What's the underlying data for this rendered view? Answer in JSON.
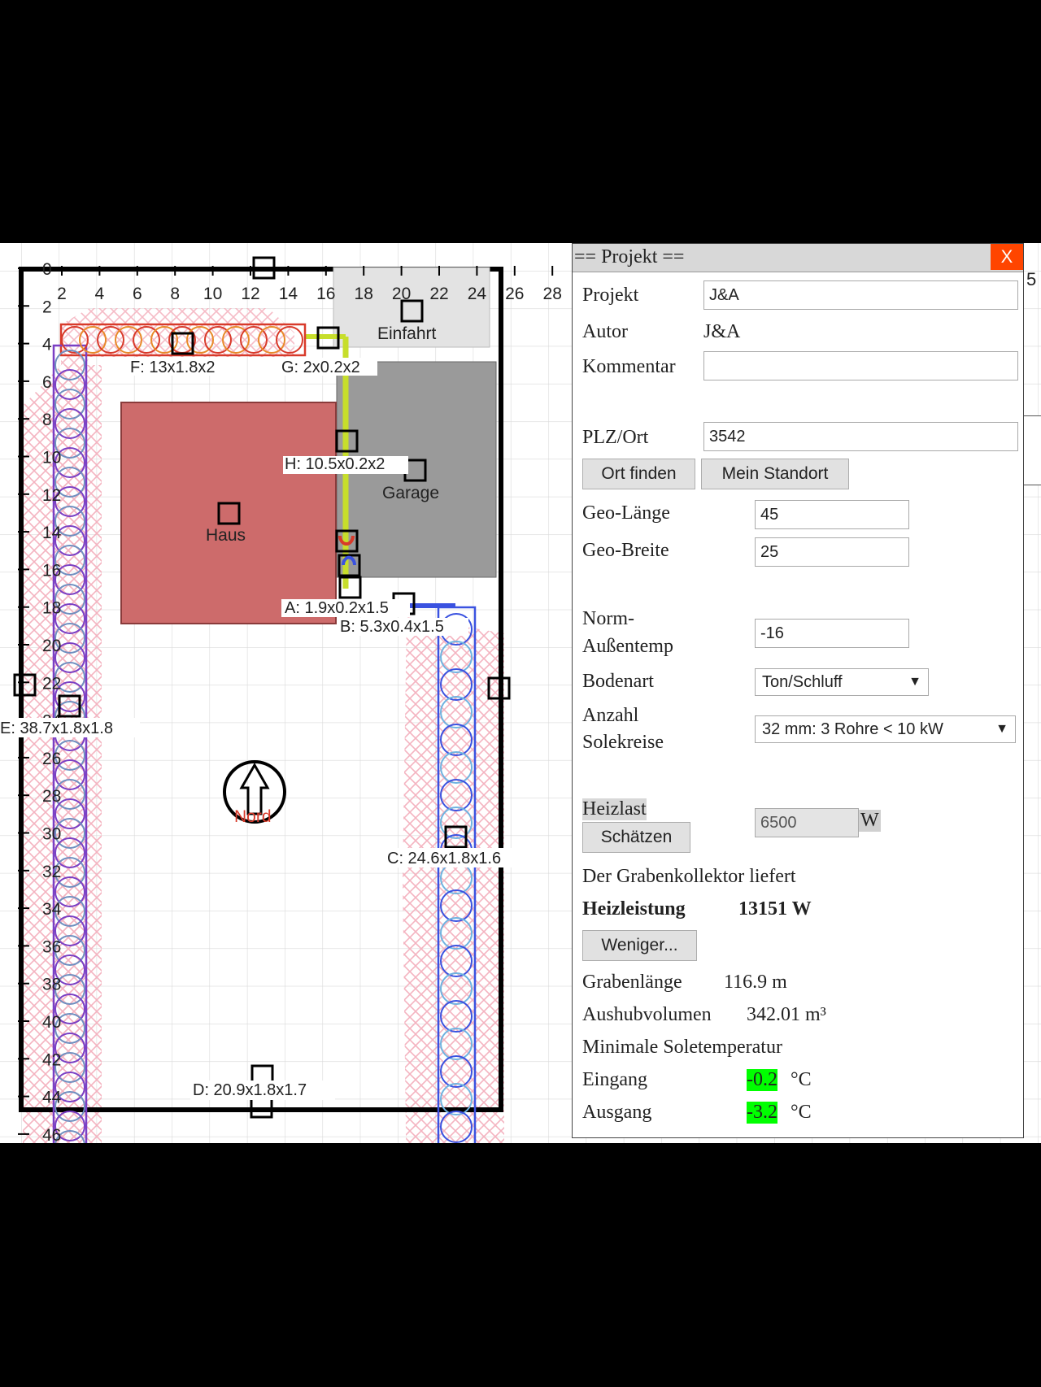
{
  "plan": {
    "x_ticks": [
      "2",
      "4",
      "6",
      "8",
      "10",
      "12",
      "14",
      "16",
      "18",
      "20",
      "22",
      "24",
      "26",
      "28"
    ],
    "y_ticks": [
      "0",
      "2",
      "4",
      "6",
      "8",
      "10",
      "12",
      "14",
      "16",
      "18",
      "20",
      "22",
      "24",
      "26",
      "28",
      "30",
      "32",
      "34",
      "36",
      "38",
      "40",
      "42",
      "44",
      "46"
    ],
    "labels": {
      "einfahrt": "Einfahrt",
      "garage": "Garage",
      "haus": "Haus",
      "nord": "Nord",
      "seg_a": "A: 1.9x0.2x1.5",
      "seg_b": "B: 5.3x0.4x1.5",
      "seg_c": "C: 24.6x1.8x1.6",
      "seg_d": "D: 20.9x1.8x1.7",
      "seg_e": "E: 38.7x1.8x1.8",
      "seg_f": "F: 13x1.8x2",
      "seg_g": "G: 2x0.2x2",
      "seg_h": "H: 10.5x0.2x2"
    },
    "edge_tick": "5",
    "colors": {
      "house": "#cd6b6b",
      "garage": "#9a9a9a",
      "driveway": "#e3e3e3",
      "hatch": "#f4b3c0",
      "coil_purple": "#7a3fc4",
      "coil_blue": "#3a52e0",
      "coil_red": "#d83a2a",
      "pipe_yellow": "#c7de2b"
    }
  },
  "panel": {
    "title": "== Projekt ==",
    "close_label": "X",
    "projekt_label": "Projekt",
    "projekt_value": "J&A",
    "autor_label": "Autor",
    "autor_value": "J&A",
    "kommentar_label": "Kommentar",
    "kommentar_value": "",
    "plz_label": "PLZ/Ort",
    "plz_value": "3542",
    "ort_finden": "Ort finden",
    "mein_standort": "Mein Standort",
    "geo_laenge_label": "Geo-Länge",
    "geo_laenge_value": "45",
    "geo_breite_label": "Geo-Breite",
    "geo_breite_value": "25",
    "norm_label_1": "Norm-",
    "norm_label_2": "Außentemp",
    "norm_value": "-16",
    "bodenart_label": "Bodenart",
    "bodenart_value": "Ton/Schluff",
    "anzahl_label_1": "Anzahl",
    "anzahl_label_2": "Solekreise",
    "anzahl_value": "32 mm: 3 Rohre < 10 kW",
    "heizlast_label": "Heizlast",
    "schaetzen": "Schätzen",
    "heizlast_value": "6500",
    "heizlast_unit": "W",
    "liefert_text": "Der Grabenkollektor liefert",
    "heizleistung_label": "Heizleistung",
    "heizleistung_value": "13151 W",
    "weniger": "Weniger...",
    "grabenlaenge_label": "Grabenlänge",
    "grabenlaenge_value": "116.9 m",
    "aushub_label": "Aushubvolumen",
    "aushub_value": "342.01 m³",
    "min_sole_label": "Minimale Soletemperatur",
    "eingang_label": "Eingang",
    "eingang_value": "-0.2",
    "ausgang_label": "Ausgang",
    "ausgang_value": "-3.2",
    "temp_unit": "°C"
  }
}
